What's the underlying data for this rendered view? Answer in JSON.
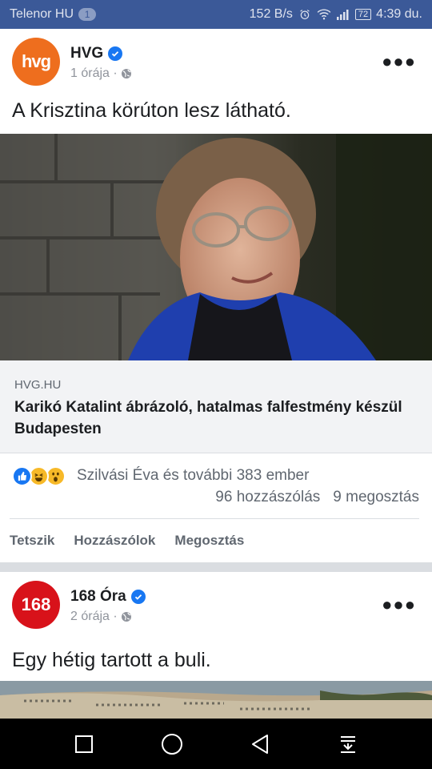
{
  "status_bar": {
    "carrier": "Telenor HU",
    "notification_count": "1",
    "speed": "152 B/s",
    "battery": "72",
    "time": "4:39 du."
  },
  "posts": [
    {
      "page_name": "HVG",
      "avatar_text": "hvg",
      "time": "1 órája ·",
      "text": "A Krisztina körúton lesz látható.",
      "link": {
        "domain": "HVG.HU",
        "title": "Karikó Katalint ábrázoló, hatalmas falfestmény készül Budapesten"
      },
      "reactions_text": "Szilvási Éva és további 383 ember",
      "comments": "96 hozzászólás",
      "shares": "9 megosztás",
      "actions": {
        "like": "Tetszik",
        "comment": "Hozzászólok",
        "share": "Megosztás"
      }
    },
    {
      "page_name": "168 Óra",
      "avatar_text": "168",
      "time": "2 órája ·",
      "text": "Egy hétig tartott a buli."
    }
  ],
  "colors": {
    "facebook_blue": "#3b5998",
    "hvg_orange": "#ee6e1e",
    "ora_red": "#d8121a",
    "verified_blue": "#1877f2"
  }
}
